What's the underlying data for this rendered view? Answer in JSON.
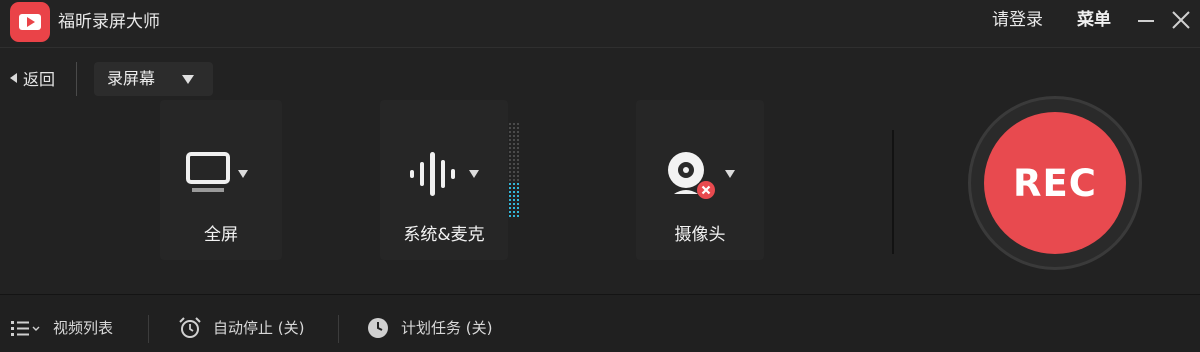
{
  "app": {
    "title": "福昕录屏大师",
    "accent": "#e84a4f"
  },
  "titlebar": {
    "login_label": "请登录",
    "menu_label": "菜单"
  },
  "toolbar": {
    "back_label": "返回",
    "mode_selected": "录屏幕"
  },
  "sources": {
    "screen_label": "全屏",
    "audio_label": "系统&麦克",
    "camera_label": "摄像头",
    "camera_status": "off"
  },
  "record": {
    "label": "REC"
  },
  "bottom": {
    "video_list_label": "视频列表",
    "auto_stop_label": "自动停止 (关)",
    "schedule_label": "计划任务 (关)"
  }
}
